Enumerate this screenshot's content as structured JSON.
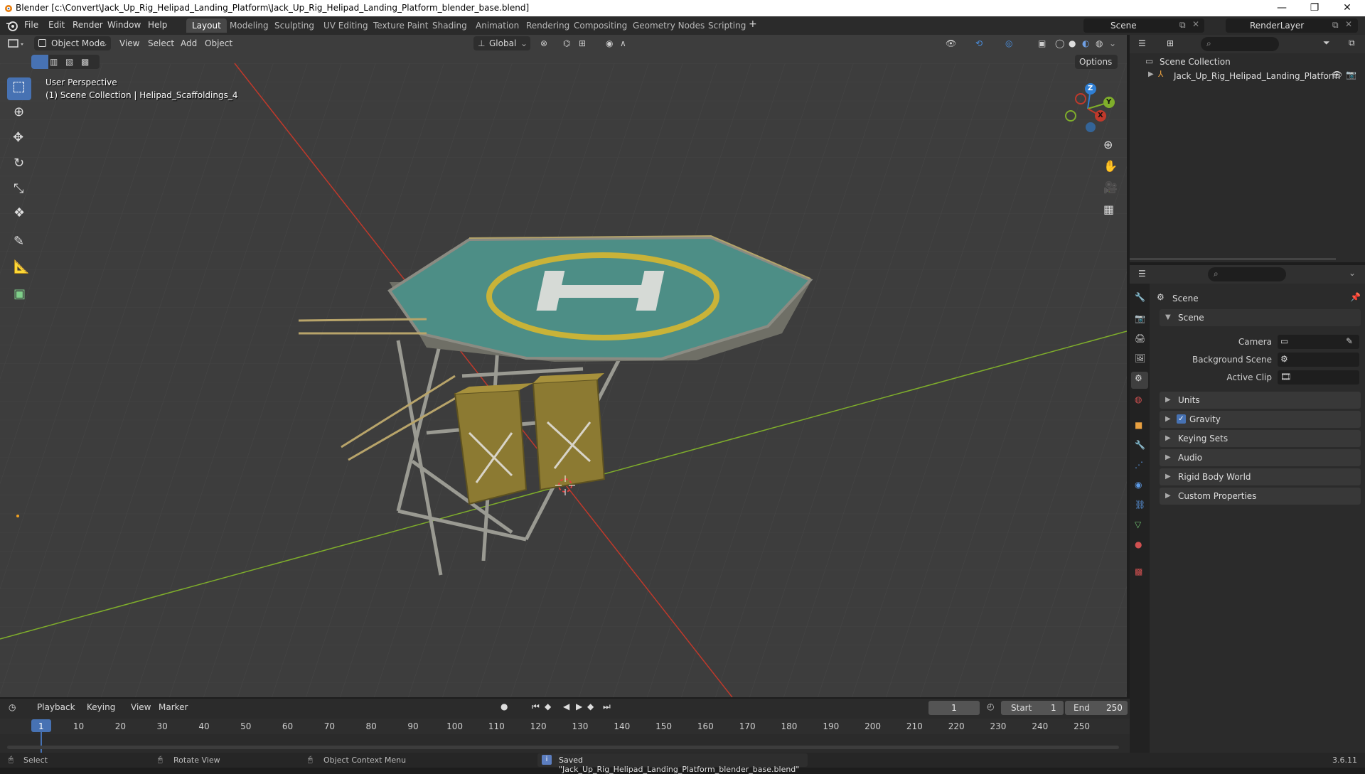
{
  "window": {
    "title": "Blender [c:\\Convert\\Jack_Up_Rig_Helipad_Landing_Platform\\Jack_Up_Rig_Helipad_Landing_Platform_blender_base.blend]",
    "minimize": "—",
    "maximize": "❐",
    "close": "✕"
  },
  "menu": {
    "file": "File",
    "edit": "Edit",
    "render": "Render",
    "window": "Window",
    "help": "Help"
  },
  "workspaces": [
    "Layout",
    "Modeling",
    "Sculpting",
    "UV Editing",
    "Texture Paint",
    "Shading",
    "Animation",
    "Rendering",
    "Compositing",
    "Geometry Nodes",
    "Scripting"
  ],
  "workspace_add": "+",
  "scene_selector": {
    "label": "Scene"
  },
  "renderlayer_selector": {
    "label": "RenderLayer"
  },
  "viewport_header": {
    "mode": "Object Mode",
    "view": "View",
    "select": "Select",
    "add": "Add",
    "object": "Object",
    "orientation": "Global",
    "options": "Options"
  },
  "viewport_overlay": {
    "perspective": "User Perspective",
    "collection": "(1) Scene Collection | Helipad_Scaffoldings_4"
  },
  "gizmo": {
    "z": "Z",
    "y": "Y",
    "x": "X"
  },
  "outliner": {
    "root": "Scene Collection",
    "items": [
      {
        "label": "Jack_Up_Rig_Helipad_Landing_Platform"
      }
    ]
  },
  "properties": {
    "header_title": "Scene",
    "scene_section": "Scene",
    "camera_label": "Camera",
    "background_scene_label": "Background Scene",
    "active_clip_label": "Active Clip",
    "sections": [
      "Units",
      "Gravity",
      "Keying Sets",
      "Audio",
      "Rigid Body World",
      "Custom Properties"
    ],
    "gravity_checked": true
  },
  "timeline": {
    "playback": "Playback",
    "keying": "Keying",
    "view": "View",
    "marker": "Marker",
    "current_frame": "1",
    "start_label": "Start",
    "start_value": "1",
    "end_label": "End",
    "end_value": "250",
    "ticks": [
      "1",
      "10",
      "20",
      "30",
      "40",
      "50",
      "60",
      "70",
      "80",
      "90",
      "100",
      "110",
      "120",
      "130",
      "140",
      "150",
      "160",
      "170",
      "180",
      "190",
      "200",
      "210",
      "220",
      "230",
      "240",
      "250"
    ]
  },
  "statusbar": {
    "select": "Select",
    "rotate_view": "Rotate View",
    "context_menu": "Object Context Menu",
    "saved_message": "Saved \"Jack_Up_Rig_Helipad_Landing_Platform_blender_base.blend\"",
    "version": "3.6.11"
  },
  "colors": {
    "accent": "#4772b3",
    "x_axis": "#c0392b",
    "y_axis": "#7fae2b",
    "z_axis": "#2f7fd4",
    "helipad_deck": "#4d8e86",
    "helipad_ring": "#c9b338"
  }
}
